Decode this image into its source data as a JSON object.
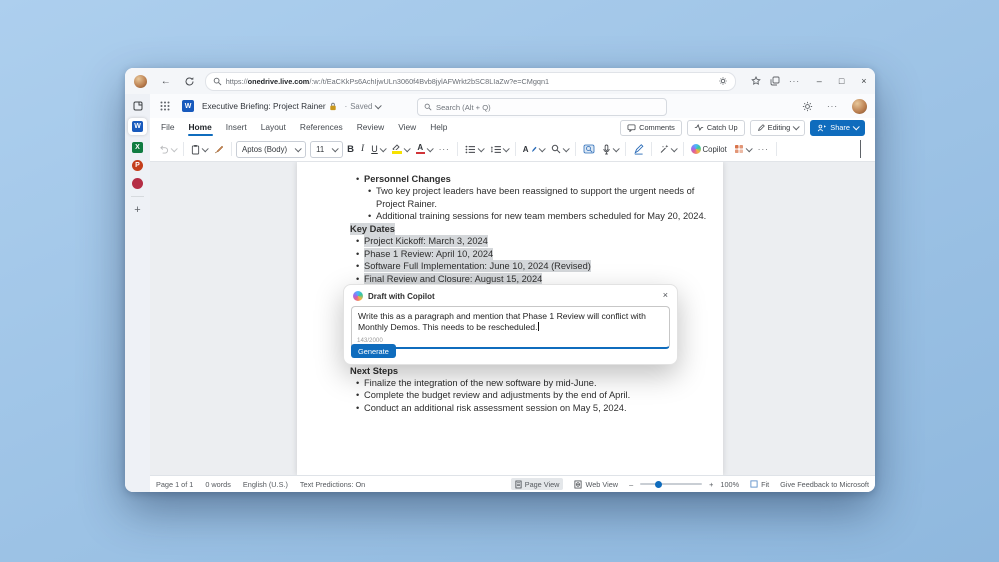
{
  "glyphs": {
    "bullet": "•",
    "back": "←",
    "more": "···",
    "min": "–",
    "max": "□",
    "close": "×",
    "plus": "+",
    "sep": "·",
    "minus": "–"
  },
  "browser": {
    "url_scheme": "https://",
    "url_host": "onedrive.live.com",
    "url_path": "/:w:/t/EaCKkPs6AchIjwULn3060f4Bvb8jylAFWrkt2bSC8LIaZw?e=CMgqn1"
  },
  "word_app": {
    "title": "Executive Briefing: Project Rainer",
    "saved_label": "Saved",
    "search_placeholder": "Search (Alt + Q)",
    "tabs": [
      {
        "label": "File"
      },
      {
        "label": "Home"
      },
      {
        "label": "Insert"
      },
      {
        "label": "Layout"
      },
      {
        "label": "References"
      },
      {
        "label": "Review"
      },
      {
        "label": "View"
      },
      {
        "label": "Help"
      }
    ],
    "active_tab": "Home",
    "comments_label": "Comments",
    "catchup_label": "Catch Up",
    "editing_label": "Editing",
    "share_label": "Share",
    "ribbon": {
      "font_name": "Aptos (Body)",
      "font_size": "11",
      "bold": "B",
      "italic": "I",
      "underline": "U",
      "font_color_letter": "A",
      "styles_letter": "A",
      "copilot_label": "Copilot"
    }
  },
  "document": {
    "lines": [
      {
        "text": "Personnel Changes"
      },
      {
        "text": "Two key project leaders have been reassigned to support the urgent needs of"
      },
      {
        "text": "Project Rainer."
      },
      {
        "text": "Additional training sessions for new team members scheduled for May 20, 2024."
      },
      {
        "text": "Key Dates"
      },
      {
        "text": "Project Kickoff: March 3, 2024"
      },
      {
        "text": "Phase 1 Review: April 10, 2024"
      },
      {
        "text": "Software Full Implementation: June 10, 2024 (Revised)"
      },
      {
        "text": "Final Review and Closure: August 15, 2024"
      },
      {
        "text": "Next Steps"
      },
      {
        "text": "Finalize the integration of the new software by mid-June."
      },
      {
        "text": "Complete the budget review and adjustments by the end of April."
      },
      {
        "text": "Conduct an additional risk assessment session on May 5, 2024."
      }
    ]
  },
  "copilot_dialog": {
    "title": "Draft with Copilot",
    "prompt": "Write this as a paragraph and mention that Phase 1 Review will conflict with Monthly Demos. This needs to be rescheduled.",
    "counter": "143/2000",
    "generate_label": "Generate"
  },
  "status_bar": {
    "page": "Page 1 of 1",
    "words": "0 words",
    "language": "English (U.S.)",
    "predictions": "Text Predictions: On",
    "page_view": "Page View",
    "web_view": "Web View",
    "zoom": "100%",
    "fit": "Fit",
    "feedback": "Give Feedback to Microsoft"
  }
}
